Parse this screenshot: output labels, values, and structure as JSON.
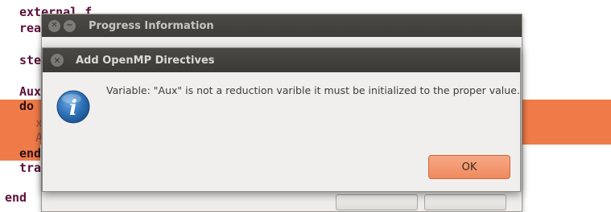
{
  "editor": {
    "lines": [
      "external f",
      "rea",
      "ste",
      "Aux",
      "do",
      "x",
      "A",
      "end",
      "tra",
      "end"
    ]
  },
  "progress_window": {
    "title": "Progress Information"
  },
  "dialog": {
    "title": "Add OpenMP Directives",
    "message": "Variable: \"Aux\" is not a reduction varible it must be initialized to the proper value.",
    "ok_label": "OK",
    "icon": "info-icon"
  },
  "colors": {
    "highlight": "#ef7c48",
    "titlebar": "#3d3c38",
    "ok_button": "#ef8a5e",
    "info_icon": "#2c6fb5"
  }
}
